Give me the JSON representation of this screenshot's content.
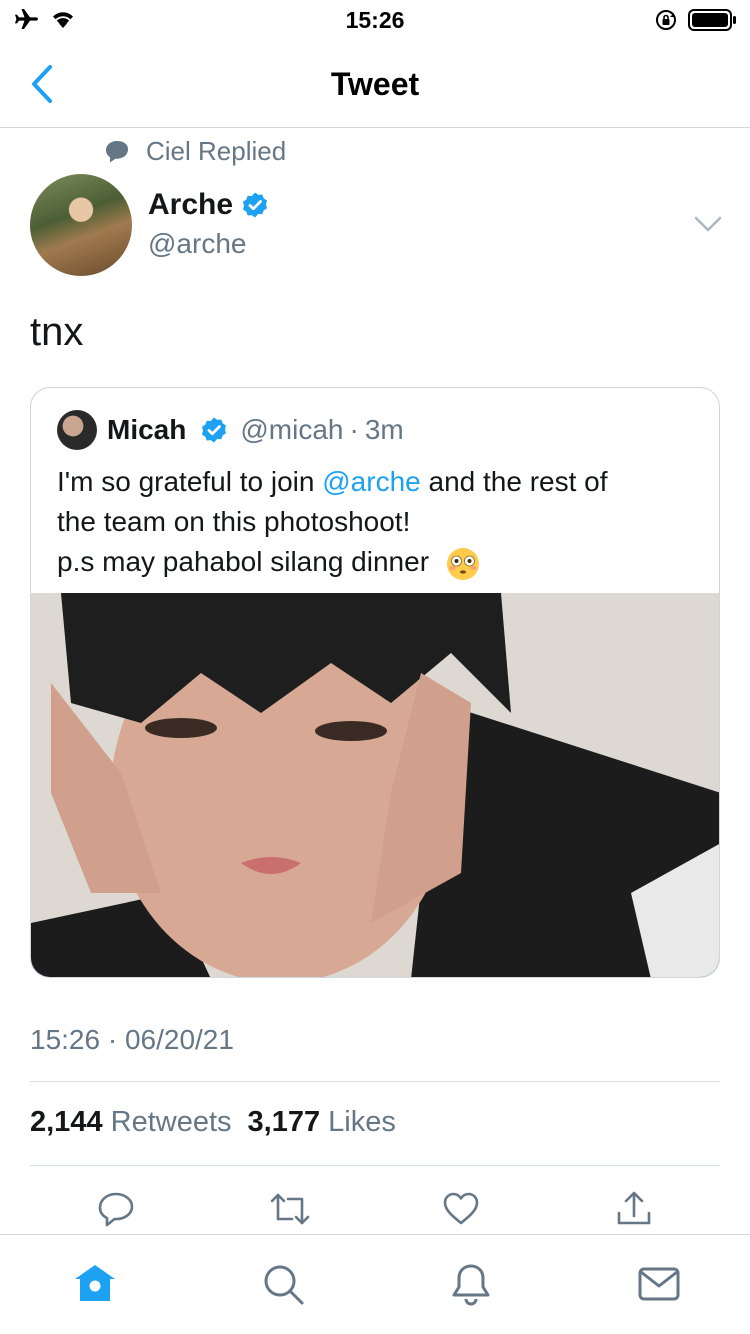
{
  "status_bar": {
    "time": "15:26"
  },
  "nav": {
    "title": "Tweet"
  },
  "social_context": {
    "text": "Ciel Replied"
  },
  "author": {
    "name": "Arche",
    "handle": "@arche",
    "verified": true
  },
  "tweet": {
    "text": "tnx"
  },
  "quoted_tweet": {
    "name": "Micah",
    "handle": "@micah",
    "separator": "·",
    "time": "3m",
    "verified": true,
    "line1_prefix": "I'm so grateful to join ",
    "line1_mention": "@arche",
    "line1_suffix": " and the rest of",
    "line2": "the team on this photoshoot!",
    "line3": "p.s may pahabol silang dinner"
  },
  "meta": {
    "timestamp": "15:26 · 06/20/21"
  },
  "stats": {
    "retweets_count": "2,144",
    "retweets_label": "Retweets",
    "likes_count": "3,177",
    "likes_label": "Likes"
  },
  "icons": {
    "actions": [
      "reply-icon",
      "retweet-icon",
      "like-icon",
      "share-icon"
    ],
    "tabs": [
      "home-icon",
      "search-icon",
      "notifications-icon",
      "messages-icon"
    ]
  },
  "colors": {
    "accent": "#1da1f2",
    "text_secondary": "#657786",
    "verified": "#1da1f2"
  }
}
